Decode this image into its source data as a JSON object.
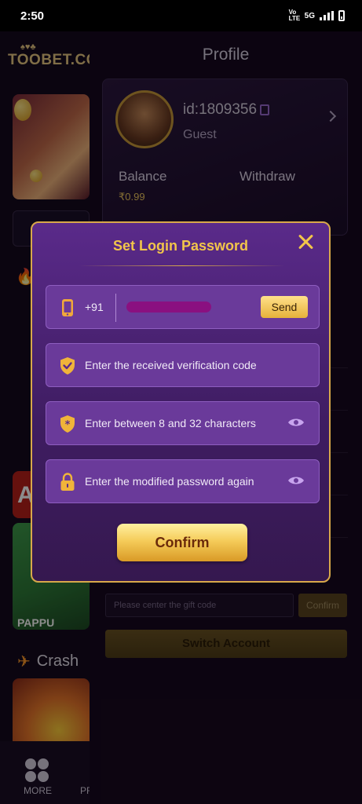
{
  "statusbar": {
    "time": "2:50",
    "network": "5G",
    "volte": "Vo LTE"
  },
  "sidebar": {
    "brand": "TOOBET.CC",
    "brand_suits": "♠♥♣",
    "games": [
      {
        "label": "PAPPU"
      }
    ],
    "tile_letter": "A",
    "crash_section": "Crash",
    "bottom_nav": [
      {
        "label": "MORE"
      },
      {
        "label": "PR"
      }
    ]
  },
  "profile": {
    "title": "Profile",
    "user_id": "id:1809356",
    "user_type": "Guest",
    "balance_label": "Balance",
    "balance_value": "₹0.99",
    "withdraw_label": "Withdraw",
    "gift_placeholder": "Please center the gift code",
    "gift_confirm": "Confirm",
    "switch_account": "Switch Account"
  },
  "modal": {
    "title": "Set Login Password",
    "phone": {
      "country_code": "+91",
      "send_label": "Send"
    },
    "fields": [
      {
        "placeholder": "Enter the received verification code",
        "icon": "shield-check-icon"
      },
      {
        "placeholder": "Enter between 8 and 32 characters",
        "icon": "shield-star-icon"
      },
      {
        "placeholder": "Enter the modified password again",
        "icon": "lock-icon"
      }
    ],
    "confirm_label": "Confirm"
  },
  "colors": {
    "accent_gold": "#f2c54a",
    "modal_bg": "#4a2374",
    "field_bg": "#6a3a9a"
  }
}
